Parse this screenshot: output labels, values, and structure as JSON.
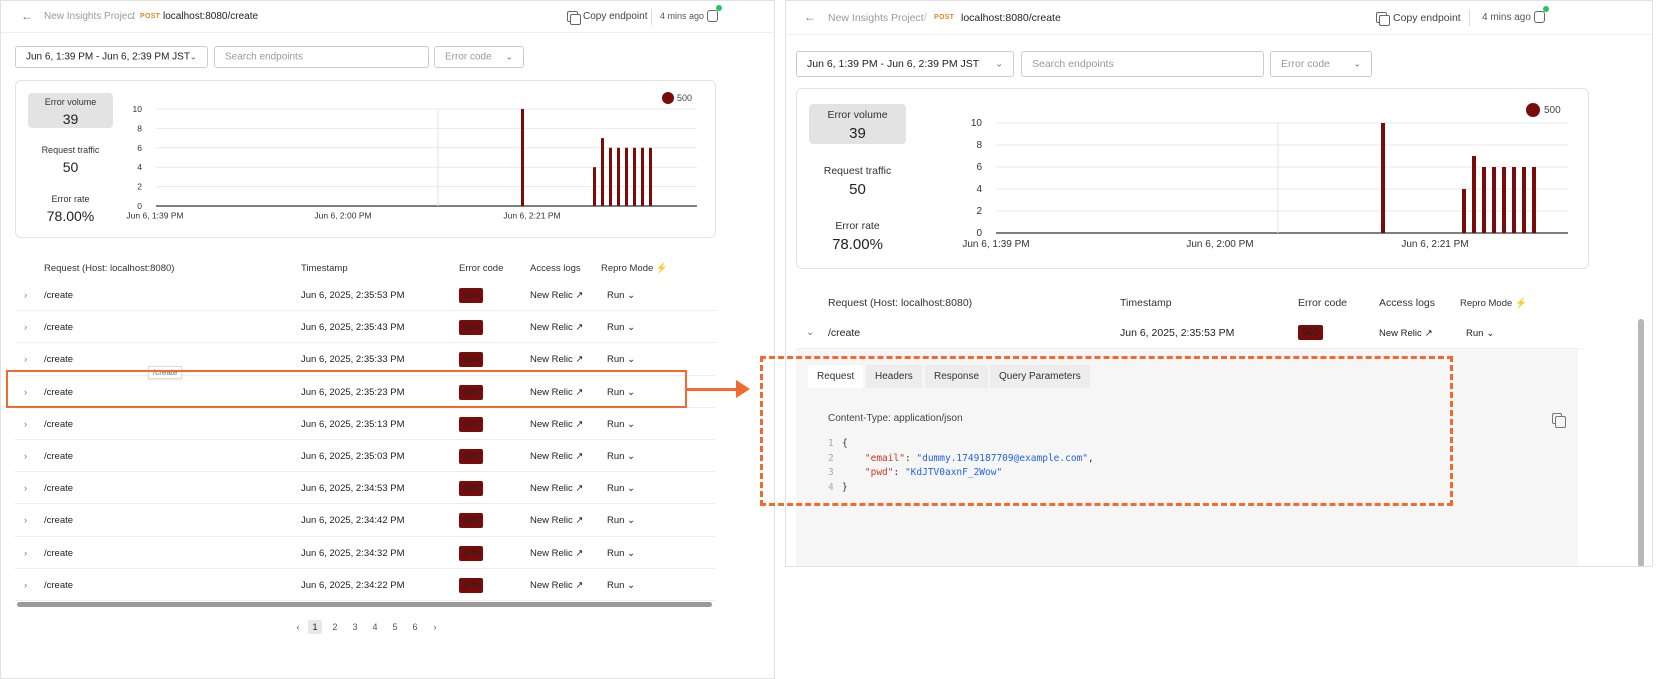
{
  "header": {
    "back_icon": "arrow-left-icon",
    "project": "New Insights Project",
    "separator": "/",
    "method": "POST",
    "endpoint": "localhost:8080/create",
    "copy_label": "Copy endpoint",
    "updated": "4 mins ago",
    "status_color": "#22c55e"
  },
  "filters": {
    "date_range": "Jun 6, 1:39 PM - Jun 6, 2:39 PM JST",
    "search_placeholder": "Search endpoints",
    "error_code_placeholder": "Error code"
  },
  "stats": {
    "error_volume_label": "Error volume",
    "error_volume": "39",
    "request_traffic_label": "Request traffic",
    "request_traffic": "50",
    "error_rate_label": "Error rate",
    "error_rate": "78.00%"
  },
  "chart_data": {
    "type": "bar",
    "legend": [
      {
        "name": "500",
        "color": "#7a0b0b"
      }
    ],
    "legend_position": "top-right",
    "ylim": [
      0,
      10
    ],
    "y_ticks": [
      "10",
      "8",
      "6",
      "4",
      "2",
      "0"
    ],
    "x_ticks": [
      "Jun 6, 1:39 PM",
      "Jun 6, 2:00 PM",
      "Jun 6, 2:21 PM"
    ],
    "grid": true,
    "series": [
      {
        "name": "500",
        "color": "#7a0b0b",
        "values": [
          10,
          4,
          7,
          6,
          6,
          6,
          6,
          6,
          6
        ]
      }
    ]
  },
  "table": {
    "columns": [
      "Request (Host: localhost:8080)",
      "Timestamp",
      "Error code",
      "Access logs",
      "Repro Mode"
    ],
    "repro_icon": "lightning-icon",
    "rows": [
      {
        "path": "/create",
        "timestamp": "Jun 6, 2025, 2:35:53 PM",
        "code": "500",
        "logs": "New Relic",
        "action": "Run"
      },
      {
        "path": "/create",
        "timestamp": "Jun 6, 2025, 2:35:43 PM",
        "code": "500",
        "logs": "New Relic",
        "action": "Run"
      },
      {
        "path": "/create",
        "timestamp": "Jun 6, 2025, 2:35:33 PM",
        "code": "500",
        "logs": "New Relic",
        "action": "Run"
      },
      {
        "path": "/create",
        "timestamp": "Jun 6, 2025, 2:35:23 PM",
        "code": "500",
        "logs": "New Relic",
        "action": "Run"
      },
      {
        "path": "/create",
        "timestamp": "Jun 6, 2025, 2:35:13 PM",
        "code": "500",
        "logs": "New Relic",
        "action": "Run"
      },
      {
        "path": "/create",
        "timestamp": "Jun 6, 2025, 2:35:03 PM",
        "code": "500",
        "logs": "New Relic",
        "action": "Run"
      },
      {
        "path": "/create",
        "timestamp": "Jun 6, 2025, 2:34:53 PM",
        "code": "500",
        "logs": "New Relic",
        "action": "Run"
      },
      {
        "path": "/create",
        "timestamp": "Jun 6, 2025, 2:34:42 PM",
        "code": "500",
        "logs": "New Relic",
        "action": "Run"
      },
      {
        "path": "/create",
        "timestamp": "Jun 6, 2025, 2:34:32 PM",
        "code": "500",
        "logs": "New Relic",
        "action": "Run"
      },
      {
        "path": "/create",
        "timestamp": "Jun 6, 2025, 2:34:22 PM",
        "code": "500",
        "logs": "New Relic",
        "action": "Run"
      }
    ],
    "tooltip": "/create"
  },
  "pagination": {
    "pages": [
      "1",
      "2",
      "3",
      "4",
      "5",
      "6"
    ],
    "current": "1"
  },
  "detail": {
    "tabs": [
      "Request",
      "Headers",
      "Response",
      "Query Parameters"
    ],
    "active_tab": "Request",
    "content_type": "Content-Type: application/json",
    "code_lines": [
      {
        "n": "1",
        "text": "{"
      },
      {
        "n": "2",
        "key": "\"email\"",
        "value": "\"dummy.1749187709@example.com\"",
        "suffix": ","
      },
      {
        "n": "3",
        "key": "\"pwd\"",
        "value": "\"KdJTV0axnF_2Wow\"",
        "suffix": ""
      },
      {
        "n": "4",
        "text": "}"
      }
    ]
  },
  "annotation_color": "#f26a2e",
  "accent_color": "#7a0b0b"
}
